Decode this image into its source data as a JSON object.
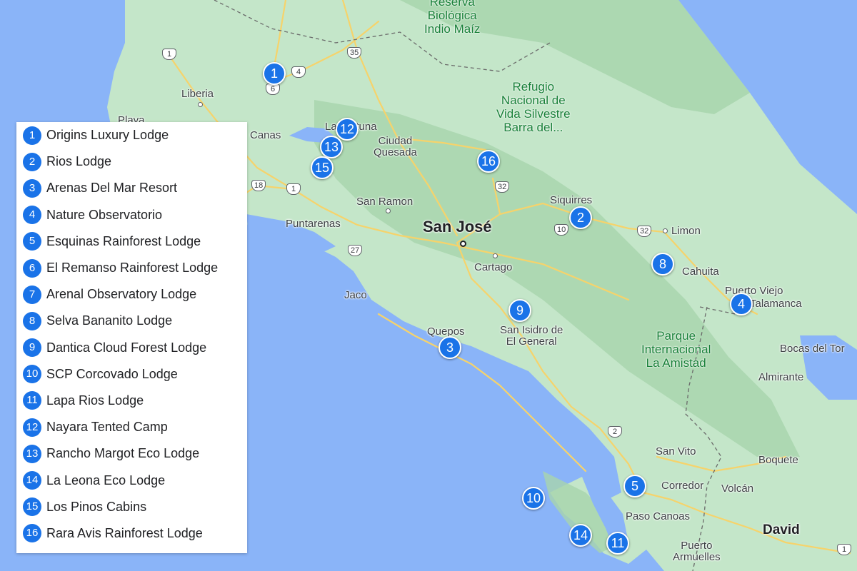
{
  "map": {
    "colors": {
      "water": "#8ab4f8",
      "land": "#c4e6c9",
      "forest": "#a8d5ad",
      "park_green": "#188038",
      "pin": "#1a73e8",
      "road": "#f6d36b"
    },
    "places": [
      {
        "id": "liberia",
        "label": "Liberia"
      },
      {
        "id": "playa",
        "label": "Playa"
      },
      {
        "id": "canas",
        "label": "Canas"
      },
      {
        "id": "la-fortuna",
        "label": "La Fortuna"
      },
      {
        "id": "ciudad-quesada",
        "label": "Ciudad\nQuesada"
      },
      {
        "id": "san-ramon",
        "label": "San Ramon"
      },
      {
        "id": "puntarenas",
        "label": "Puntarenas"
      },
      {
        "id": "san-jose",
        "label": "San José"
      },
      {
        "id": "cartago",
        "label": "Cartago"
      },
      {
        "id": "siquirres",
        "label": "Siquirres"
      },
      {
        "id": "limon",
        "label": "Limon"
      },
      {
        "id": "cahuita",
        "label": "Cahuita"
      },
      {
        "id": "puerto-viejo",
        "label": "Puerto Viejo"
      },
      {
        "id": "talamanca",
        "label": "Talamanca"
      },
      {
        "id": "jaco",
        "label": "Jaco"
      },
      {
        "id": "quepos",
        "label": "Quepos"
      },
      {
        "id": "san-isidro",
        "label": "San Isidro de\nEl General"
      },
      {
        "id": "bocas",
        "label": "Bocas del Tor"
      },
      {
        "id": "almirante",
        "label": "Almirante"
      },
      {
        "id": "san-vito",
        "label": "San Vito"
      },
      {
        "id": "boquete",
        "label": "Boquete"
      },
      {
        "id": "corredor",
        "label": "Corredor"
      },
      {
        "id": "volcan",
        "label": "Volcán"
      },
      {
        "id": "paso-canoas",
        "label": "Paso Canoas"
      },
      {
        "id": "david",
        "label": "David"
      },
      {
        "id": "puerto-armuelles",
        "label": "Puerto\nArmuelles"
      }
    ],
    "parks": [
      {
        "id": "indio-maiz",
        "label": "Reserva\nBiológica\nIndio Maíz"
      },
      {
        "id": "barra-del",
        "label": "Refugio\nNacional de\nVida Silvestre\nBarra del..."
      },
      {
        "id": "la-amistad",
        "label": "Parque\nInternacional\nLa Amistad"
      }
    ],
    "shields": [
      "1",
      "4",
      "6",
      "35",
      "18",
      "1",
      "27",
      "32",
      "10",
      "32",
      "2",
      "1"
    ],
    "pins": [
      "1",
      "12",
      "13",
      "15",
      "16",
      "2",
      "8",
      "4",
      "9",
      "3",
      "5",
      "10",
      "14",
      "11"
    ]
  },
  "legend": {
    "items": [
      {
        "num": "1",
        "label": "Origins Luxury Lodge"
      },
      {
        "num": "2",
        "label": "Rios Lodge"
      },
      {
        "num": "3",
        "label": "Arenas Del Mar Resort"
      },
      {
        "num": "4",
        "label": "Nature Observatorio"
      },
      {
        "num": "5",
        "label": "Esquinas Rainforest Lodge"
      },
      {
        "num": "6",
        "label": "El Remanso Rainforest Lodge"
      },
      {
        "num": "7",
        "label": "Arenal Observatory Lodge"
      },
      {
        "num": "8",
        "label": "Selva Bananito Lodge"
      },
      {
        "num": "9",
        "label": "Dantica Cloud Forest Lodge"
      },
      {
        "num": "10",
        "label": "SCP Corcovado Lodge"
      },
      {
        "num": "11",
        "label": "Lapa Rios Lodge"
      },
      {
        "num": "12",
        "label": "Nayara Tented Camp"
      },
      {
        "num": "13",
        "label": "Rancho Margot Eco Lodge"
      },
      {
        "num": "14",
        "label": "La Leona Eco Lodge"
      },
      {
        "num": "15",
        "label": "Los Pinos Cabins"
      },
      {
        "num": "16",
        "label": "Rara Avis Rainforest Lodge"
      }
    ]
  }
}
